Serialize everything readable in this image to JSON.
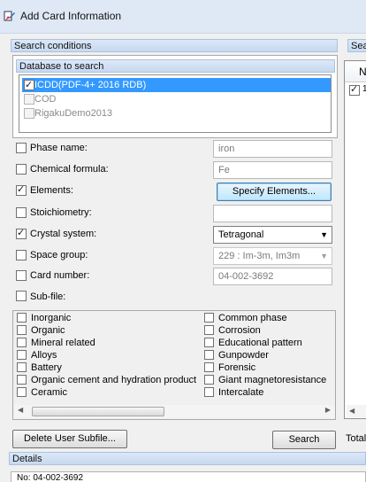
{
  "window": {
    "title": "Add Card Information"
  },
  "search_conditions": {
    "header": "Search conditions",
    "right_header_partial": "Sea"
  },
  "database": {
    "header": "Database to search",
    "items": [
      {
        "label": "ICDD(PDF-4+ 2016 RDB)",
        "checked": true,
        "selected": true
      },
      {
        "label": "COD",
        "checked": false,
        "selected": false
      },
      {
        "label": "RigakuDemo2013",
        "checked": false,
        "selected": false
      }
    ]
  },
  "criteria": {
    "phase_name": {
      "label": "Phase name:",
      "value": "iron",
      "checked": false
    },
    "chemical_formula": {
      "label": "Chemical formula:",
      "value": "Fe",
      "checked": false
    },
    "elements": {
      "label": "Elements:",
      "button": "Specify Elements...",
      "checked": true
    },
    "stoichiometry": {
      "label": "Stoichiometry:",
      "value": "",
      "checked": false
    },
    "crystal_system": {
      "label": "Crystal system:",
      "value": "Tetragonal",
      "checked": true
    },
    "space_group": {
      "label": "Space group:",
      "value": "229 : Im-3m, Im3m",
      "checked": false
    },
    "card_number": {
      "label": "Card number:",
      "value": "04-002-3692",
      "checked": false
    },
    "sub_file": {
      "label": "Sub-file:",
      "checked": false
    }
  },
  "subfiles": {
    "col1": [
      "Inorganic",
      "Organic",
      "Mineral related",
      "Alloys",
      "Battery",
      "Organic cement and hydration product",
      "Ceramic"
    ],
    "col2": [
      "Common phase",
      "Corrosion",
      "Educational pattern",
      "Gunpowder",
      "Forensic",
      "Giant magnetoresistance",
      "Intercalate"
    ]
  },
  "buttons": {
    "delete_subfile": "Delete User Subfile...",
    "search": "Search"
  },
  "right_partial": {
    "total_label": "Total",
    "col_header": "N",
    "row_mark": "1"
  },
  "details": {
    "header": "Details",
    "text": "No: 04-002-3692"
  }
}
